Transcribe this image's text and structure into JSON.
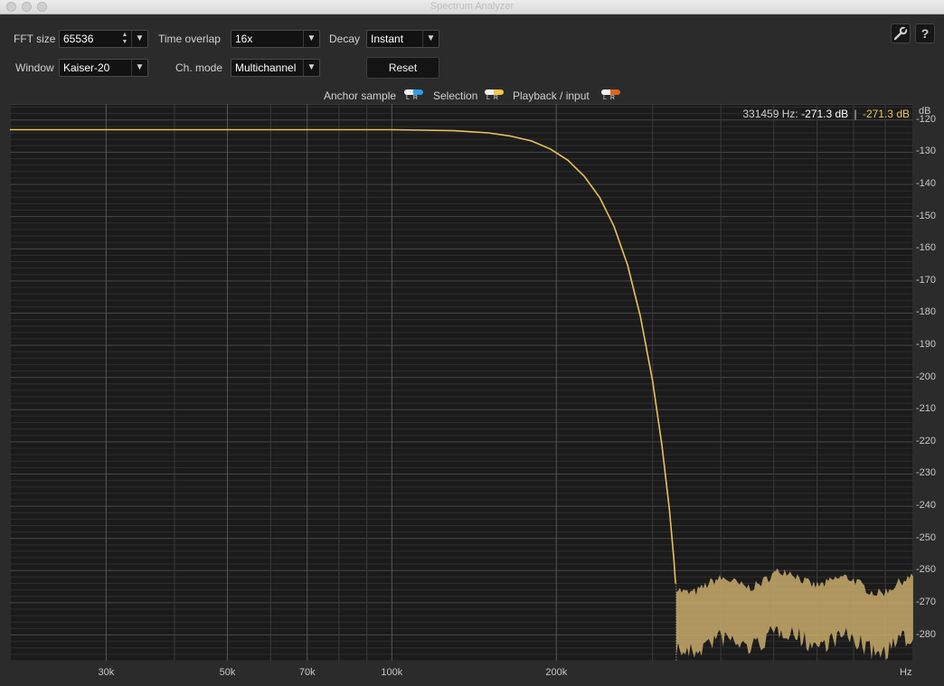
{
  "window": {
    "title": "Spectrum Analyzer"
  },
  "controls": {
    "fft_size_label": "FFT size",
    "fft_size_value": "65536",
    "time_overlap_label": "Time overlap",
    "time_overlap_value": "16x",
    "decay_label": "Decay",
    "decay_value": "Instant",
    "window_label": "Window",
    "window_value": "Kaiser-20",
    "ch_mode_label": "Ch. mode",
    "ch_mode_value": "Multichannel",
    "reset_label": "Reset",
    "settings_icon": "wrench-icon",
    "help_label": "?"
  },
  "legend": {
    "anchor_label": "Anchor sample",
    "selection_label": "Selection",
    "playback_label": "Playback / input",
    "lr_text": "LR",
    "anchor_color": "#2aa0e8",
    "selection_color": "#f2c64a",
    "playback_color": "#e0641e"
  },
  "readout": {
    "frequency": "331459 Hz:",
    "value_left": "-271.3 dB",
    "separator": "|",
    "value_right": "-271.3 dB"
  },
  "chart_data": {
    "type": "line",
    "y_unit_label": "dB",
    "x_unit_label": "Hz",
    "x_scale": "log",
    "xlim": [
      20000,
      900000
    ],
    "ylim": [
      -115,
      -288
    ],
    "x_ticks": [
      {
        "value": 30000,
        "label": "30k"
      },
      {
        "value": 50000,
        "label": "50k"
      },
      {
        "value": 70000,
        "label": "70k"
      },
      {
        "value": 100000,
        "label": "100k"
      },
      {
        "value": 200000,
        "label": "200k"
      }
    ],
    "y_ticks": [
      -120,
      -130,
      -140,
      -150,
      -160,
      -170,
      -180,
      -190,
      -200,
      -210,
      -220,
      -230,
      -240,
      -250,
      -260,
      -270,
      -280
    ],
    "grid": true,
    "series": [
      {
        "color": "#e8c25a",
        "x": [
          20000,
          100000,
          130000,
          150000,
          165000,
          180000,
          195000,
          210000,
          225000,
          240000,
          255000,
          270000,
          285000,
          300000,
          312000,
          322000,
          328000,
          330500
        ],
        "y": [
          -123,
          -123,
          -123.3,
          -124,
          -125,
          -126.5,
          -129,
          -132.5,
          -137.5,
          -144,
          -153,
          -165,
          -181,
          -201,
          -221,
          -241,
          -256,
          -264
        ]
      }
    ],
    "noise_floor": {
      "x_start": 331459,
      "x_end": 900000,
      "y_top": -263,
      "y_bottom": -281,
      "color": "#c9ab6b"
    },
    "cursor_x": 331459
  }
}
